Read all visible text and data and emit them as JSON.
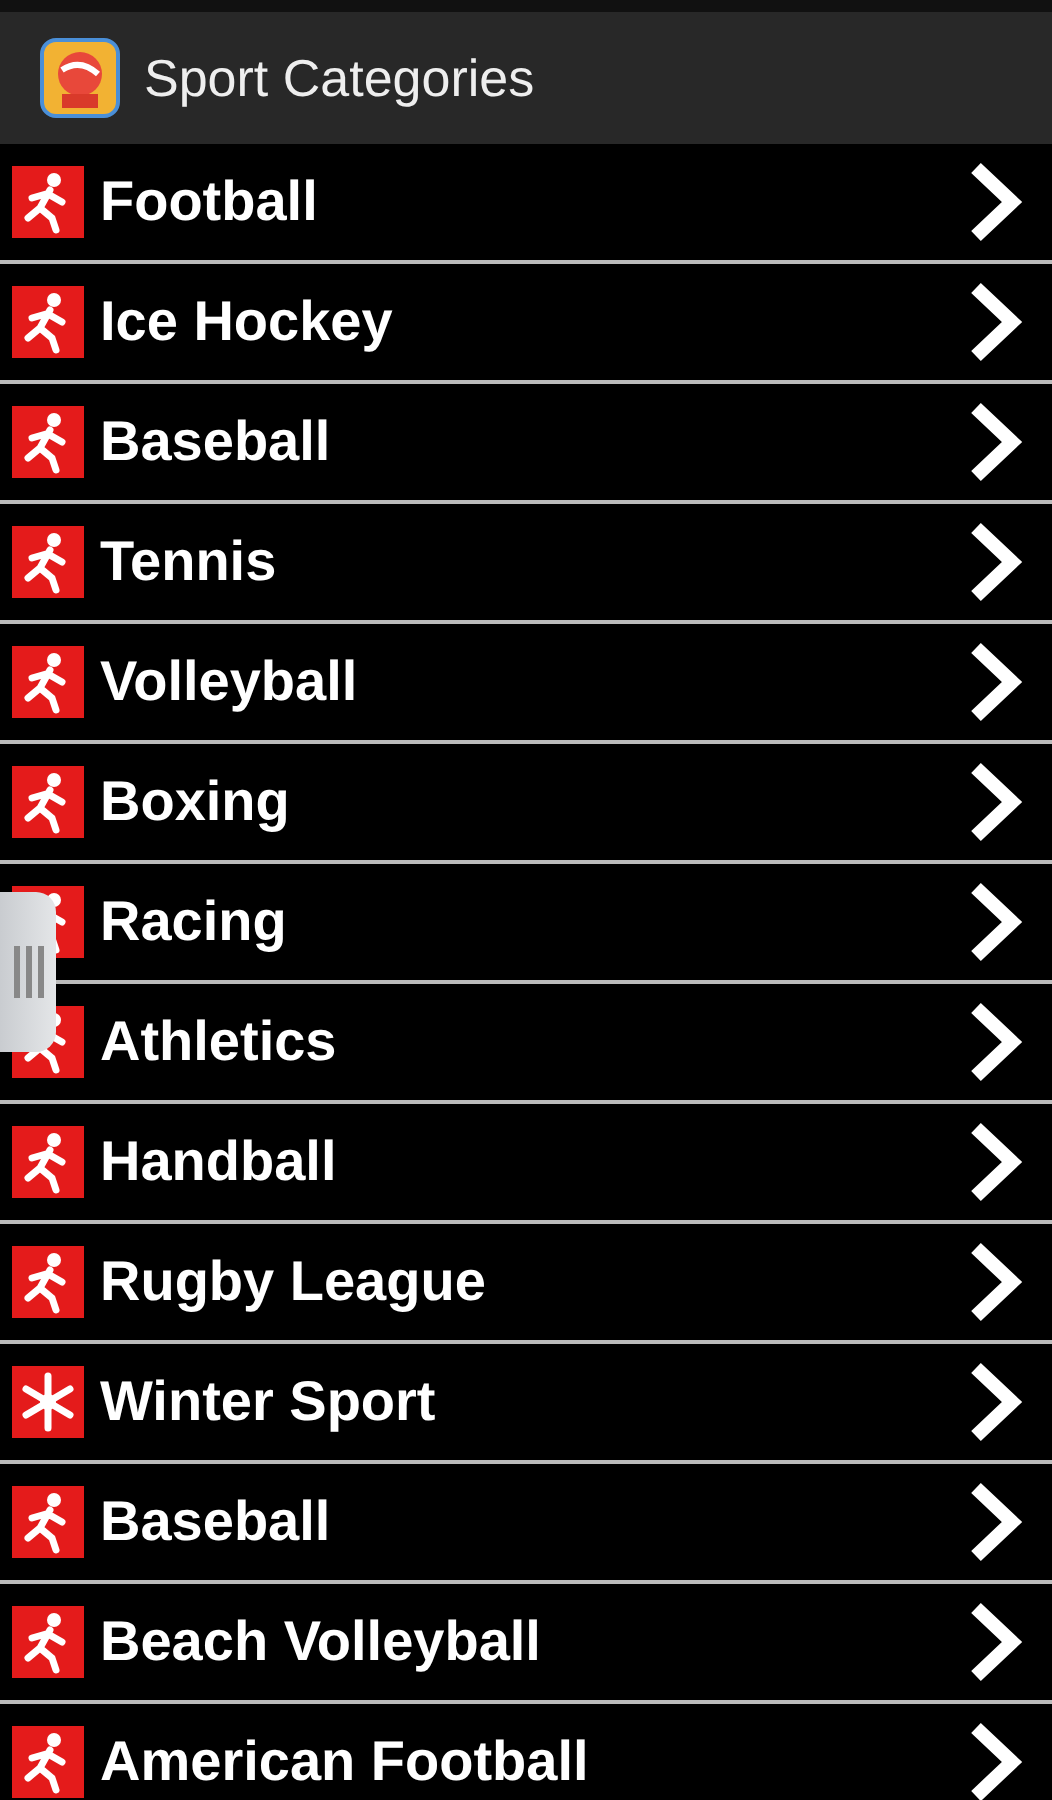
{
  "header": {
    "title": "Sport Categories"
  },
  "categories": [
    {
      "label": "Football",
      "kind": "figure"
    },
    {
      "label": "Ice Hockey",
      "kind": "figure"
    },
    {
      "label": "Baseball",
      "kind": "figure"
    },
    {
      "label": "Tennis",
      "kind": "figure"
    },
    {
      "label": "Volleyball",
      "kind": "figure"
    },
    {
      "label": "Boxing",
      "kind": "figure"
    },
    {
      "label": "Racing",
      "kind": "figure"
    },
    {
      "label": "Athletics",
      "kind": "figure"
    },
    {
      "label": "Handball",
      "kind": "figure"
    },
    {
      "label": "Rugby League",
      "kind": "figure"
    },
    {
      "label": "Winter Sport",
      "kind": "snowflake"
    },
    {
      "label": "Baseball",
      "kind": "figure"
    },
    {
      "label": "Beach Volleyball",
      "kind": "figure"
    },
    {
      "label": "American Football",
      "kind": "figure"
    }
  ]
}
